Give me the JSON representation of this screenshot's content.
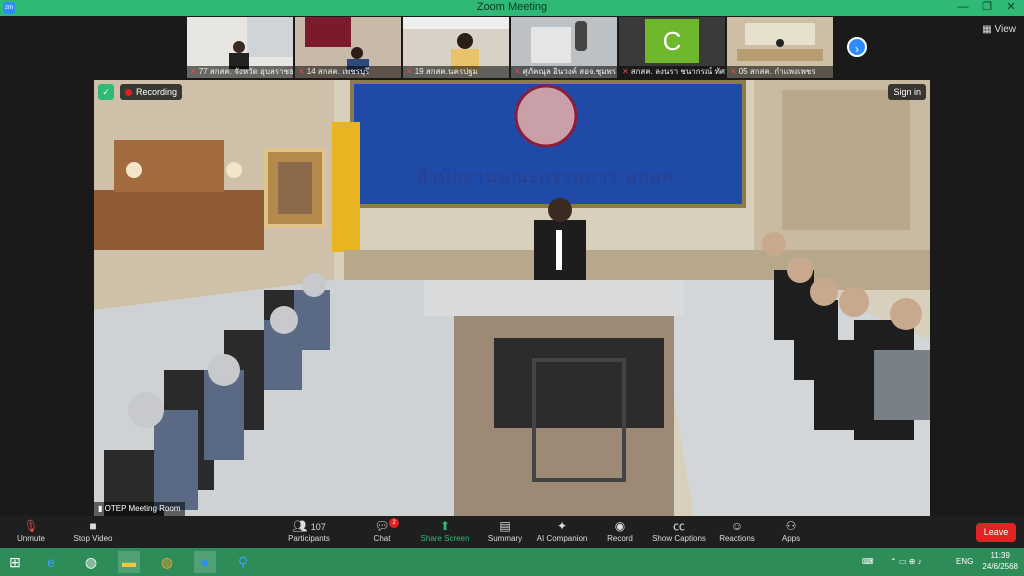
{
  "window": {
    "title": "Zoom Meeting"
  },
  "view_label": "View",
  "thumbnails": [
    {
      "name": "77 สกสค. จังหวัด อุบลราชธานี"
    },
    {
      "name": "14 สกสค. เพชรบุรี"
    },
    {
      "name": "19 สกสค.นครปฐม"
    },
    {
      "name": "ศุภัคณุล อินวงค์ สอจ.ชุมพร"
    },
    {
      "name": "สกสค. ลงนรา ชนากรณ์ ทัศ...",
      "avatar_letter": "C"
    },
    {
      "name": "05 สกสค. กำแพงเพชร"
    }
  ],
  "video": {
    "recording_label": "Recording",
    "sign_in_label": "Sign in",
    "backdrop_text": "สำนักงานคณะกรรมการ สกสค.",
    "speaker_name": "OTEP Meeting Room"
  },
  "toolbar": {
    "unmute": "Unmute",
    "stop_video": "Stop Video",
    "participants": "Participants",
    "participants_count": "107",
    "chat": "Chat",
    "chat_badge": "2",
    "share_screen": "Share Screen",
    "summary": "Summary",
    "ai_companion": "AI Companion",
    "record": "Record",
    "show_captions": "Show Captions",
    "reactions": "Reactions",
    "apps": "Apps",
    "leave": "Leave"
  },
  "taskbar": {
    "lang": "ENG",
    "time": "11:39",
    "date": "24/6/2568"
  },
  "colors": {
    "accent_green": "#2fb876",
    "leave_red": "#e02424",
    "zoom_blue": "#2d8cff"
  }
}
